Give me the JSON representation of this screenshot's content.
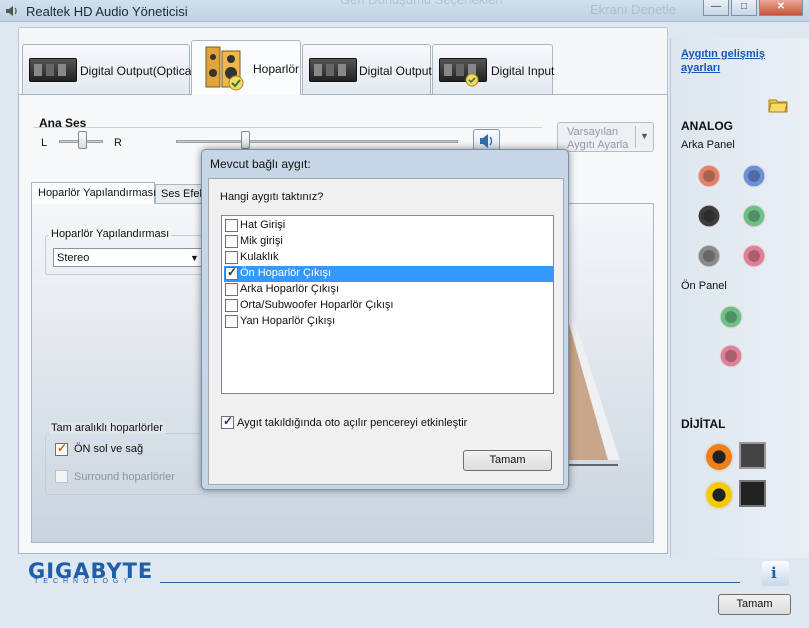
{
  "window": {
    "title": "Realtek HD Audio Yöneticisi",
    "ghost_text_1": "Geri Dönüşümü Seçenekleri",
    "ghost_text_2": "Ekranı Denetle",
    "minimize": "—",
    "maximize": "□",
    "close": "✕"
  },
  "tabs": [
    {
      "label": "Digital Output(Optical)"
    },
    {
      "label": "Hoparlör"
    },
    {
      "label": "Digital Output"
    },
    {
      "label": "Digital Input"
    }
  ],
  "main_volume": {
    "label": "Ana Ses",
    "left": "L",
    "right": "R",
    "default_device_line1": "Varsayılan",
    "default_device_line2": "Aygıtı Ayarla"
  },
  "subtabs": [
    {
      "label": "Hoparlör Yapılandırması"
    },
    {
      "label": "Ses Efekt"
    }
  ],
  "speaker_config": {
    "group_label": "Hoparlör Yapılandırması",
    "select_value": "Stereo",
    "full_range_label": "Tam aralıklı hoparlörler",
    "front_lr_label": "ÖN sol ve sağ",
    "front_lr_checked": true,
    "surround_label": "Surround hoparlörler",
    "surround_checked": false
  },
  "right_panel": {
    "advanced_link_line1": "Aygıtın gelişmiş",
    "advanced_link_line2": "ayarları",
    "analog_heading": "ANALOG",
    "back_panel_label": "Arka Panel",
    "front_panel_label": "Ön Panel",
    "digital_heading": "DİJİTAL",
    "back_jacks": [
      "#e2826a",
      "#6b8fd8",
      "#3c3c3c",
      "#6fbf86",
      "#8a8a8a",
      "#e07f95"
    ],
    "front_jacks": [
      "#6fbf86",
      "#e07f95"
    ]
  },
  "footer": {
    "brand": "GIGABYTE",
    "brand_sub": "TECHNOLOGY",
    "ok_button": "Tamam"
  },
  "dialog": {
    "title": "Mevcut bağlı aygıt:",
    "question": "Hangi aygıtı taktınız?",
    "items": [
      {
        "label": "Hat Girişi",
        "checked": false,
        "selected": false
      },
      {
        "label": "Mik girişi",
        "checked": false,
        "selected": false
      },
      {
        "label": "Kulaklık",
        "checked": false,
        "selected": false
      },
      {
        "label": "Ön Hoparlör Çıkışı",
        "checked": true,
        "selected": true
      },
      {
        "label": "Arka Hoparlör Çıkışı",
        "checked": false,
        "selected": false
      },
      {
        "label": "Orta/Subwoofer Hoparlör Çıkışı",
        "checked": false,
        "selected": false
      },
      {
        "label": "Yan Hoparlör Çıkışı",
        "checked": false,
        "selected": false
      }
    ],
    "autopopup_label": "Aygıt takıldığında oto açılır pencereyi etkinleştir",
    "autopopup_checked": true,
    "ok_button": "Tamam"
  }
}
